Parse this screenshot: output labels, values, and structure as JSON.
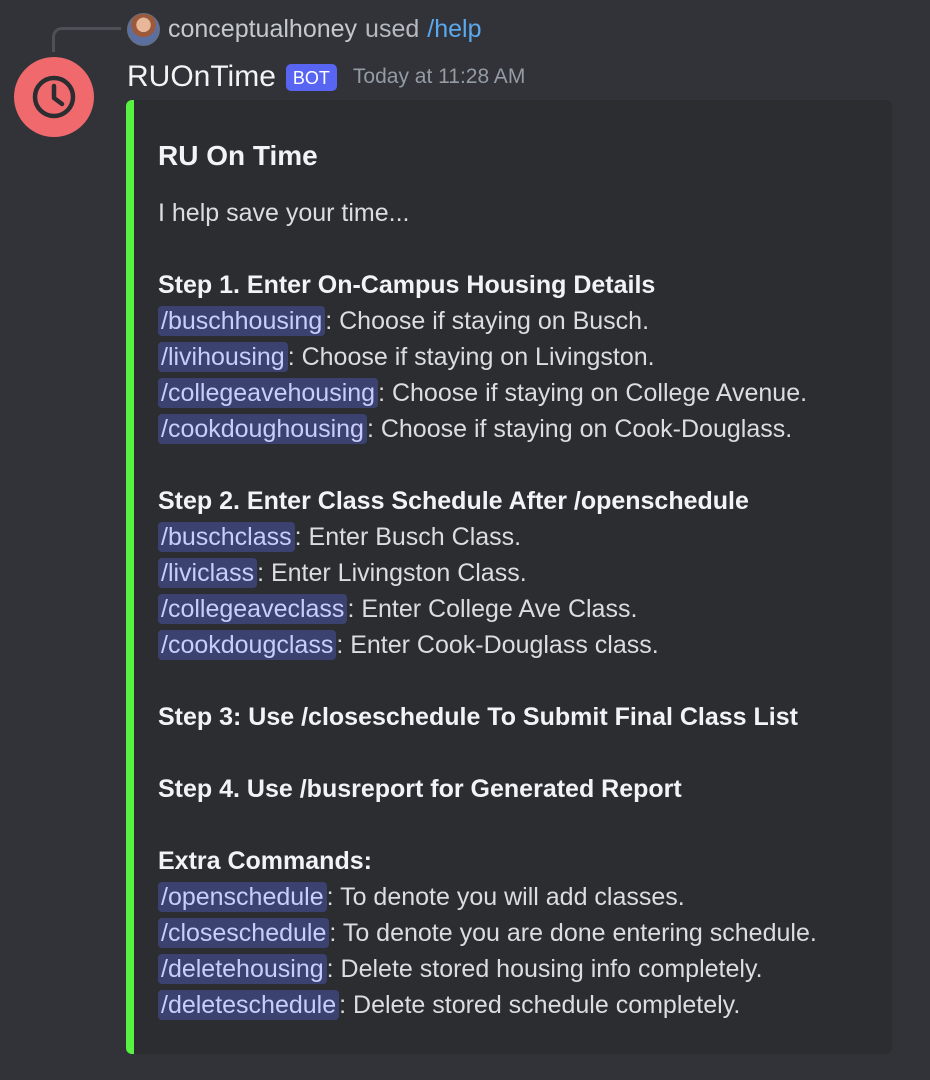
{
  "reply": {
    "username": "conceptualhoney",
    "used": "used",
    "command": "/help"
  },
  "message": {
    "author": "RUOnTime",
    "badge": "BOT",
    "timestamp": "Today at 11:28 AM"
  },
  "embed": {
    "accent_color": "#57f242",
    "title": "RU On Time",
    "intro": "I help save your time...",
    "step1": {
      "heading": "Step 1. Enter On-Campus Housing Details",
      "items": [
        {
          "cmd": "/buschhousing",
          "desc": ": Choose if staying on Busch."
        },
        {
          "cmd": "/livihousing",
          "desc": ": Choose if staying on Livingston."
        },
        {
          "cmd": "/collegeavehousing",
          "desc": ": Choose if staying on College Avenue."
        },
        {
          "cmd": "/cookdoughousing",
          "desc": ": Choose if staying on Cook-Douglass."
        }
      ]
    },
    "step2": {
      "heading": "Step 2. Enter Class Schedule After /openschedule",
      "items": [
        {
          "cmd": "/buschclass",
          "desc": ": Enter Busch Class."
        },
        {
          "cmd": "/liviclass",
          "desc": ": Enter Livingston Class."
        },
        {
          "cmd": "/collegeaveclass",
          "desc": ": Enter College Ave Class."
        },
        {
          "cmd": "/cookdougclass",
          "desc": ": Enter Cook-Douglass class."
        }
      ]
    },
    "step3": "Step 3: Use /closeschedule To Submit Final Class List",
    "step4": "Step 4. Use /busreport for Generated Report",
    "extra": {
      "heading": "Extra Commands:",
      "items": [
        {
          "cmd": "/openschedule",
          "desc": ": To denote you will add classes."
        },
        {
          "cmd": "/closeschedule",
          "desc": ": To denote you are done entering schedule."
        },
        {
          "cmd": "/deletehousing",
          "desc": ": Delete stored housing info completely."
        },
        {
          "cmd": "/deleteschedule",
          "desc": ": Delete stored schedule completely."
        }
      ]
    }
  },
  "icons": {
    "avatar": "clock-icon",
    "reply_avatar": "user-avatar"
  },
  "colors": {
    "background": "#313338",
    "embed_bg": "#2b2d31",
    "bot_badge": "#5865f2",
    "avatar_bg": "#f06a6d",
    "link": "#5aa9ef"
  }
}
